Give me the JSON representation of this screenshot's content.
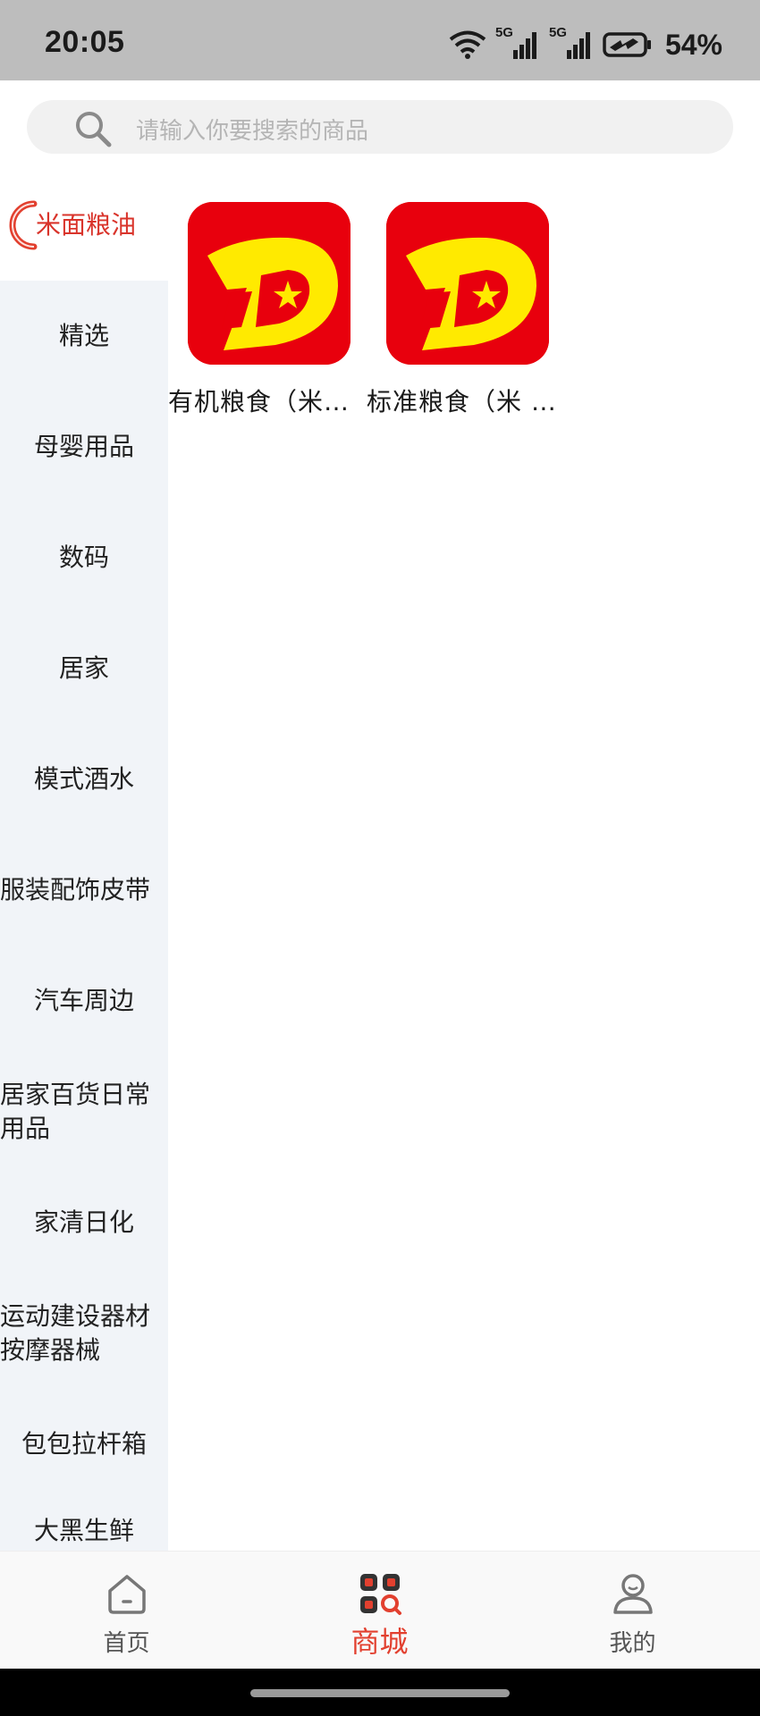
{
  "status_bar": {
    "time": "20:05",
    "signal_1_label": "5G",
    "signal_2_label": "5G",
    "battery_percent": "54%"
  },
  "search": {
    "placeholder": "请输入你要搜索的商品"
  },
  "sidebar": {
    "items": [
      {
        "label": "米面粮油",
        "active": true
      },
      {
        "label": "精选"
      },
      {
        "label": "母婴用品"
      },
      {
        "label": "数码"
      },
      {
        "label": "居家"
      },
      {
        "label": "模式酒水"
      },
      {
        "label": "服装配饰皮带"
      },
      {
        "label": "汽车周边"
      },
      {
        "label": "居家百货日常\n用品"
      },
      {
        "label": "家清日化"
      },
      {
        "label": "运动建设器材\n按摩器械"
      },
      {
        "label": "包包拉杆箱"
      },
      {
        "label": "大黑生鲜"
      }
    ]
  },
  "products": [
    {
      "name": "有机粮食（米…",
      "logo_icon": "brand-logo-icon"
    },
    {
      "name": "标准粮食（米 …",
      "logo_icon": "brand-logo-icon"
    }
  ],
  "bottom_nav": {
    "items": [
      {
        "label": "首页",
        "icon": "home-icon"
      },
      {
        "label": "商城",
        "icon": "mall-grid-icon",
        "active": true
      },
      {
        "label": "我的",
        "icon": "user-icon"
      }
    ]
  },
  "colors": {
    "accent": "#e2402f",
    "logo_red": "#e8000d",
    "logo_yellow": "#ffea00",
    "sidebar_bg": "#f1f4f8"
  }
}
